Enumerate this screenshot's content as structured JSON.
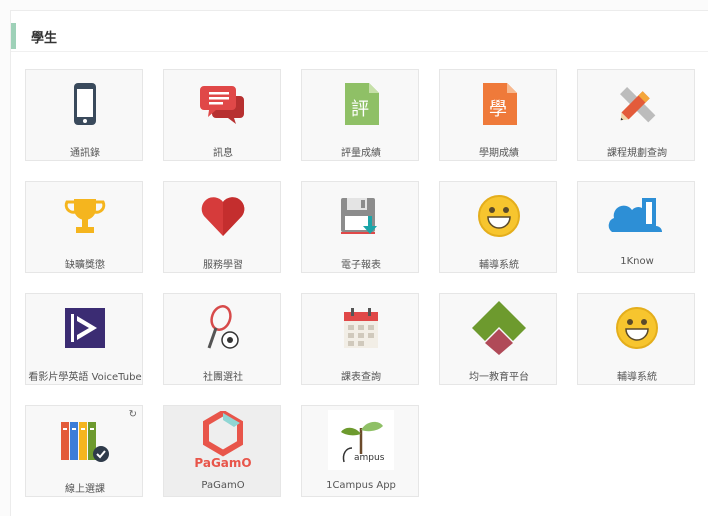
{
  "section": {
    "title": "學生"
  },
  "tiles": [
    {
      "label": "通訊錄",
      "icon": "phone-icon"
    },
    {
      "label": "訊息",
      "icon": "message-icon"
    },
    {
      "label": "評量成績",
      "icon": "evaluation-grade-icon",
      "glyph": "評"
    },
    {
      "label": "學期成績",
      "icon": "semester-grade-icon",
      "glyph": "學"
    },
    {
      "label": "課程規劃查詢",
      "icon": "ruler-pencil-icon"
    },
    {
      "label": "缺曠獎懲",
      "icon": "trophy-icon"
    },
    {
      "label": "服務學習",
      "icon": "heart-icon"
    },
    {
      "label": "電子報表",
      "icon": "floppy-download-icon"
    },
    {
      "label": "輔導系統",
      "icon": "smiley-icon"
    },
    {
      "label": "1Know",
      "icon": "1know-cloud-icon"
    },
    {
      "label": "看影片學英語 VoiceTube",
      "icon": "voicetube-logo-icon"
    },
    {
      "label": "社團選社",
      "icon": "racket-ball-icon"
    },
    {
      "label": "課表查詢",
      "icon": "calendar-icon"
    },
    {
      "label": "均一教育平台",
      "icon": "junyi-diamond-icon"
    },
    {
      "label": "輔導系統",
      "icon": "smiley-icon"
    },
    {
      "label": "線上選課",
      "icon": "binders-check-icon",
      "badge": "refresh-icon"
    },
    {
      "label": "PaGamO",
      "icon": "pagamo-logo-icon",
      "logo_text": "PaGamO"
    },
    {
      "label": "1Campus App",
      "icon": "1campus-logo-icon",
      "logo_text": "ampus"
    }
  ]
}
